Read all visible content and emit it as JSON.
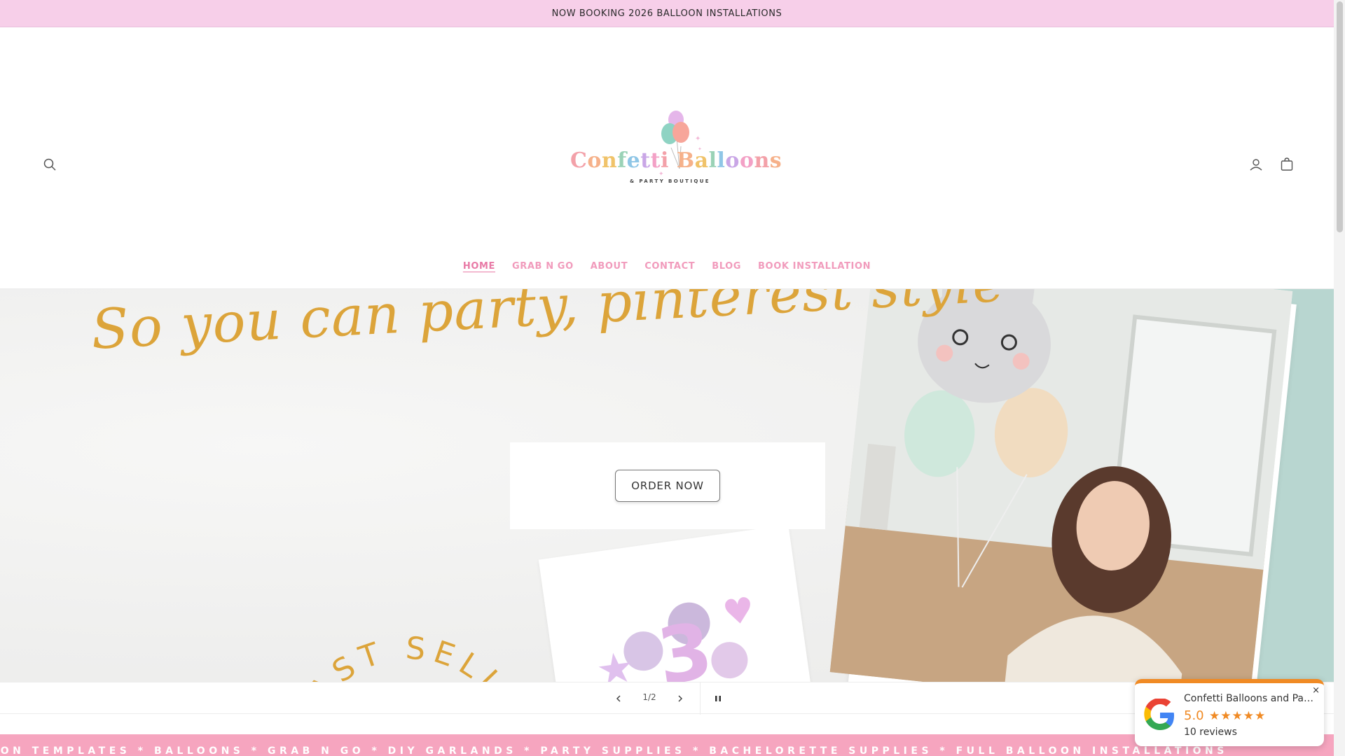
{
  "announcement": "NOW BOOKING 2026 BALLOON INSTALLATIONS",
  "logo": {
    "name": "Confetti Balloons",
    "sub": "& PARTY BOUTIQUE"
  },
  "nav": [
    "HOME",
    "GRAB N GO",
    "ABOUT",
    "CONTACT",
    "BLOG",
    "BOOK INSTALLATION"
  ],
  "hero": {
    "tagline": "So you can party, pinterest style",
    "button": "ORDER NOW",
    "badge_text": "FAST SELLING"
  },
  "slider": {
    "counter": "1/2"
  },
  "marquee": "ION TEMPLATES * BALLOONS * GRAB N GO * DIY GARLANDS * PARTY SUPPLIES * BACHELORETTE SUPPLIES * FULL BALLOON INSTALLATIONS",
  "review": {
    "name": "Confetti Balloons and Part...",
    "score": "5.0",
    "stars": "★★★★★",
    "count": "10 reviews",
    "close": "×"
  },
  "icons": [
    "search-icon",
    "account-icon",
    "cart-icon",
    "chevron-left-icon",
    "chevron-right-icon",
    "pause-icon",
    "google-logo-icon",
    "close-icon"
  ],
  "colors": {
    "announce_bg": "#f7cfe9",
    "nav": "#f19bbc",
    "tagline": "#dca43a",
    "marquee_bg": "#f6a5bf",
    "accent_orange": "#f08a24",
    "mint": "#b8d6d0"
  }
}
